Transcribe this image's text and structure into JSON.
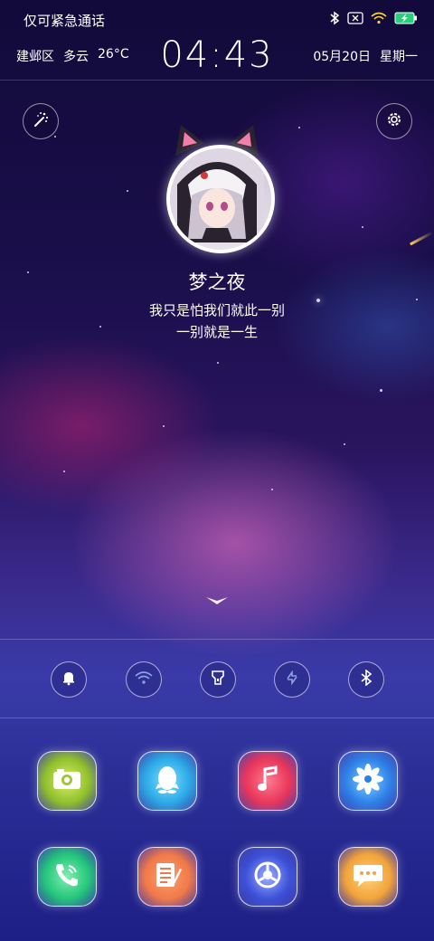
{
  "status_bar": {
    "carrier": "仅可紧急通话",
    "icons": [
      "bluetooth-icon",
      "no-sim-icon",
      "wifi-icon",
      "battery-charging-icon"
    ]
  },
  "header": {
    "location": "建邺区",
    "weather": "多云",
    "temperature": "26°C",
    "time": "04:43",
    "date": "05月20日",
    "weekday": "星期一"
  },
  "profile": {
    "name": "梦之夜",
    "motto_line1": "我只是怕我们就此一别",
    "motto_line2": "一别就是一生"
  },
  "top_buttons": [
    "magic-wand-icon",
    "settings-icon"
  ],
  "quick_toggles": [
    "bell-icon",
    "wifi-icon",
    "flashlight-icon",
    "rotation-icon",
    "bluetooth-icon"
  ],
  "apps": [
    {
      "icon": "camera-icon",
      "color": "#a8d13a"
    },
    {
      "icon": "qq-penguin-icon",
      "color": "#2ab0e6"
    },
    {
      "icon": "music-icon",
      "color": "#e8345a"
    },
    {
      "icon": "gallery-flower-icon",
      "color": "#2d7fe8"
    },
    {
      "icon": "phone-icon",
      "color": "#22c47a"
    },
    {
      "icon": "notes-icon",
      "color": "#f07848"
    },
    {
      "icon": "browser-icon",
      "color": "#3b4fd8"
    },
    {
      "icon": "messages-icon",
      "color": "#f2a33a"
    }
  ]
}
